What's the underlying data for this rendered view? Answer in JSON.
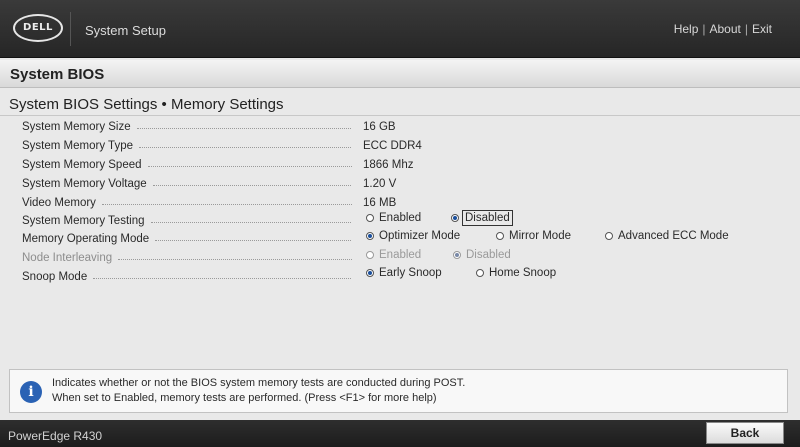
{
  "header": {
    "logo_text": "DELL",
    "app_title": "System Setup",
    "links": {
      "help": "Help",
      "about": "About",
      "exit": "Exit",
      "separator": "|"
    }
  },
  "section": {
    "title": "System BIOS"
  },
  "page": {
    "title": "System BIOS Settings • Memory Settings"
  },
  "settings": [
    {
      "label": "System Memory Size",
      "value": "16 GB"
    },
    {
      "label": "System Memory Type",
      "value": "ECC DDR4"
    },
    {
      "label": "System Memory Speed",
      "value": "1866 Mhz"
    },
    {
      "label": "System Memory Voltage",
      "value": "1.20 V"
    },
    {
      "label": "Video Memory",
      "value": "16 MB"
    },
    {
      "label": "System Memory Testing",
      "options": [
        "Enabled",
        "Disabled"
      ],
      "selected": "Disabled"
    },
    {
      "label": "Memory Operating Mode",
      "options": [
        "Optimizer Mode",
        "Mirror Mode",
        "Advanced ECC Mode"
      ],
      "selected": "Optimizer Mode"
    },
    {
      "label": "Node Interleaving",
      "options": [
        "Enabled",
        "Disabled"
      ],
      "selected": "Disabled",
      "disabled": true
    },
    {
      "label": "Snoop Mode",
      "options": [
        "Early Snoop",
        "Home Snoop"
      ],
      "selected": "Early Snoop"
    }
  ],
  "help": {
    "line1": "Indicates whether or not the BIOS system memory tests are conducted during POST.",
    "line2": "When set to Enabled, memory tests are performed. (Press <F1> for more help)"
  },
  "footer": {
    "model": "PowerEdge R430",
    "back_label": "Back"
  },
  "colors": {
    "accent": "#2a62b4",
    "radio_selected": "#1a4f9c"
  },
  "icons": {
    "info": "info-icon"
  }
}
